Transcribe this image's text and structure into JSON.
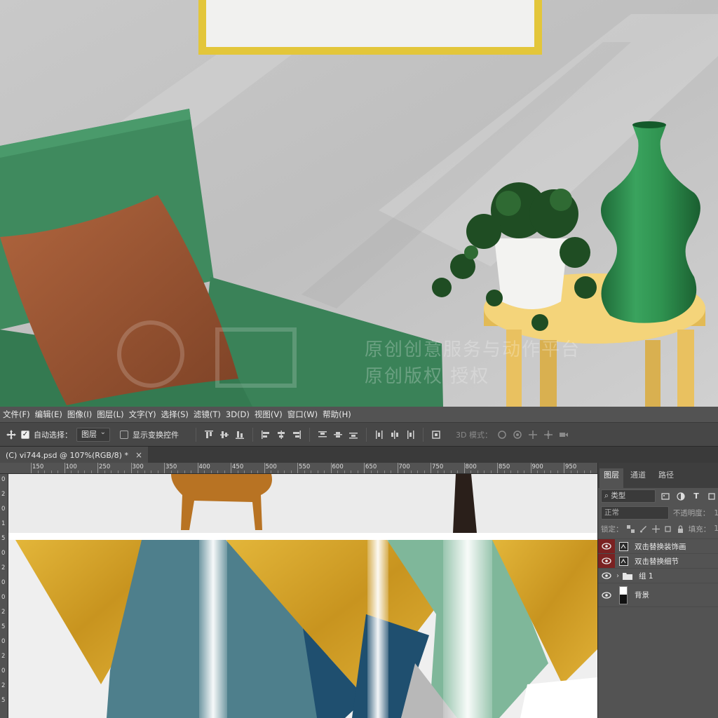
{
  "scene": {
    "watermark_lines": [
      "原创创意服务与动作平台",
      "原创版权 授权"
    ]
  },
  "menu": {
    "items": [
      "文件(F)",
      "编辑(E)",
      "图像(I)",
      "图层(L)",
      "文字(Y)",
      "选择(S)",
      "滤镜(T)",
      "3D(D)",
      "视图(V)",
      "窗口(W)",
      "帮助(H)"
    ]
  },
  "options": {
    "auto_select_label": "自动选择：",
    "auto_select_value": "图层",
    "show_transform_label": "显示变换控件",
    "mode_3d_label": "3D 模式："
  },
  "document": {
    "tab_title": "(C) vi744.psd @ 107%(RGB/8) *",
    "close_glyph": "×"
  },
  "ruler": {
    "top_labels": [
      "150",
      "100",
      "250",
      "300",
      "350",
      "400",
      "450",
      "500",
      "550",
      "600",
      "650",
      "700",
      "750",
      "800",
      "850",
      "900",
      "950"
    ],
    "left_labels": [
      "0",
      "2",
      "0",
      "1",
      "5",
      "0",
      "2",
      "0",
      "0",
      "2",
      "5",
      "0",
      "2",
      "0",
      "2",
      "5"
    ]
  },
  "layers_panel": {
    "tabs": [
      "图层",
      "通道",
      "路径"
    ],
    "active_tab": 0,
    "filter_label": "类型",
    "blend_mode": "正常",
    "opacity_label": "不透明度：",
    "opacity_value": "1",
    "lock_label": "锁定：",
    "fill_label": "填充：",
    "fill_value": "1",
    "layers": [
      {
        "name": "双击替换装饰画",
        "type": "smart",
        "highlight": true
      },
      {
        "name": "双击替换细节",
        "type": "smart",
        "highlight": true
      },
      {
        "name": "组 1",
        "type": "group",
        "highlight": false
      },
      {
        "name": "背景",
        "type": "image",
        "highlight": false
      }
    ]
  },
  "colors": {
    "chair": "#3f8a5e",
    "pillow": "#9a5634",
    "frame": "#e3c63a",
    "table": "#f1cd6b",
    "vase": "#2f9350",
    "gold": "#d7a52c",
    "teal": "#4e7f8c",
    "navy": "#1f4f6f",
    "mint": "#7fb79a"
  }
}
